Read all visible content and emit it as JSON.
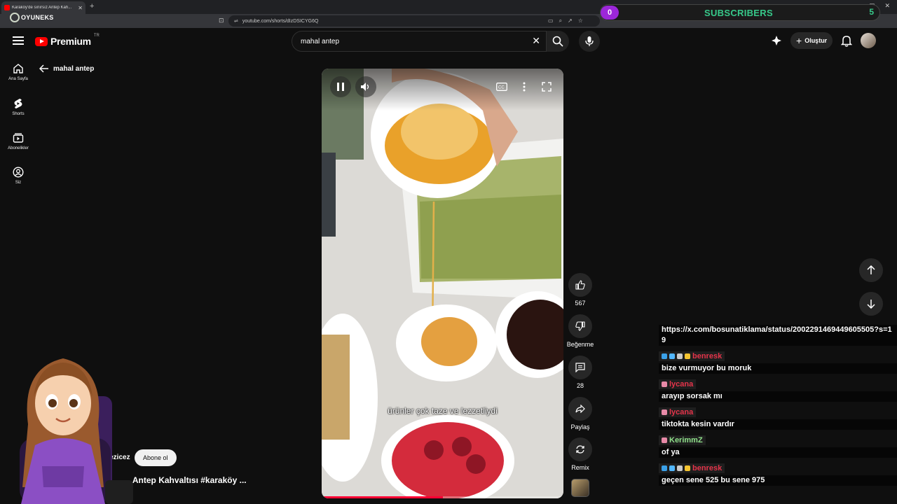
{
  "browser": {
    "tab_title": "Karaköy'de sınırsız Antep Kah...",
    "url": "youtube.com/shorts/dIzDSICYG6Q",
    "overlay_logo": "OYUNEKS"
  },
  "subscribers": {
    "count": "0",
    "label": "SUBSCRIBERS",
    "goal": "5"
  },
  "header": {
    "logo_text": "Premium",
    "country_code": "TR",
    "search_value": "mahal antep",
    "create_label": "Oluştur"
  },
  "sidebar": {
    "items": [
      {
        "label": "Ana Sayfa",
        "icon": "home-icon"
      },
      {
        "label": "Shorts",
        "icon": "shorts-icon"
      },
      {
        "label": "Abonelikler",
        "icon": "subscriptions-icon"
      },
      {
        "label": "Siz",
        "icon": "account-icon"
      }
    ]
  },
  "back_label": "mahal antep",
  "video": {
    "caption": "ürünler çok taze ve lezzetliydi",
    "progress": 0.5,
    "channel": "gezicez",
    "subscribe_label": "Abone ol",
    "title": "... Antep Kahvaltısı #karaköy ..."
  },
  "actions": {
    "like_count": "567",
    "dislike_label": "Beğenme",
    "comment_count": "28",
    "share_label": "Paylaş",
    "remix_label": "Remix"
  },
  "chat": [
    {
      "user": "",
      "text": "https://x.com/bosunatiklama/status/2002291469449605505?s=19"
    },
    {
      "user": "benresk",
      "text": "bize vurmuyor bu moruk",
      "color": "#e5344a"
    },
    {
      "user": "lycana",
      "text": "arayıp sorsak mı",
      "color": "#e5344a"
    },
    {
      "user": "lycana",
      "text": "tiktokta kesin vardır",
      "color": "#e5344a"
    },
    {
      "user": "KerimmZ",
      "text": "of ya",
      "color": "#8fe08a"
    },
    {
      "user": "benresk",
      "text": "geçen sene 525 bu sene 975",
      "color": "#e5344a"
    }
  ],
  "colors": {
    "accent": "#ff0000",
    "subscribers_green": "#37c98a",
    "subscribers_purple": "#9c27d9"
  }
}
